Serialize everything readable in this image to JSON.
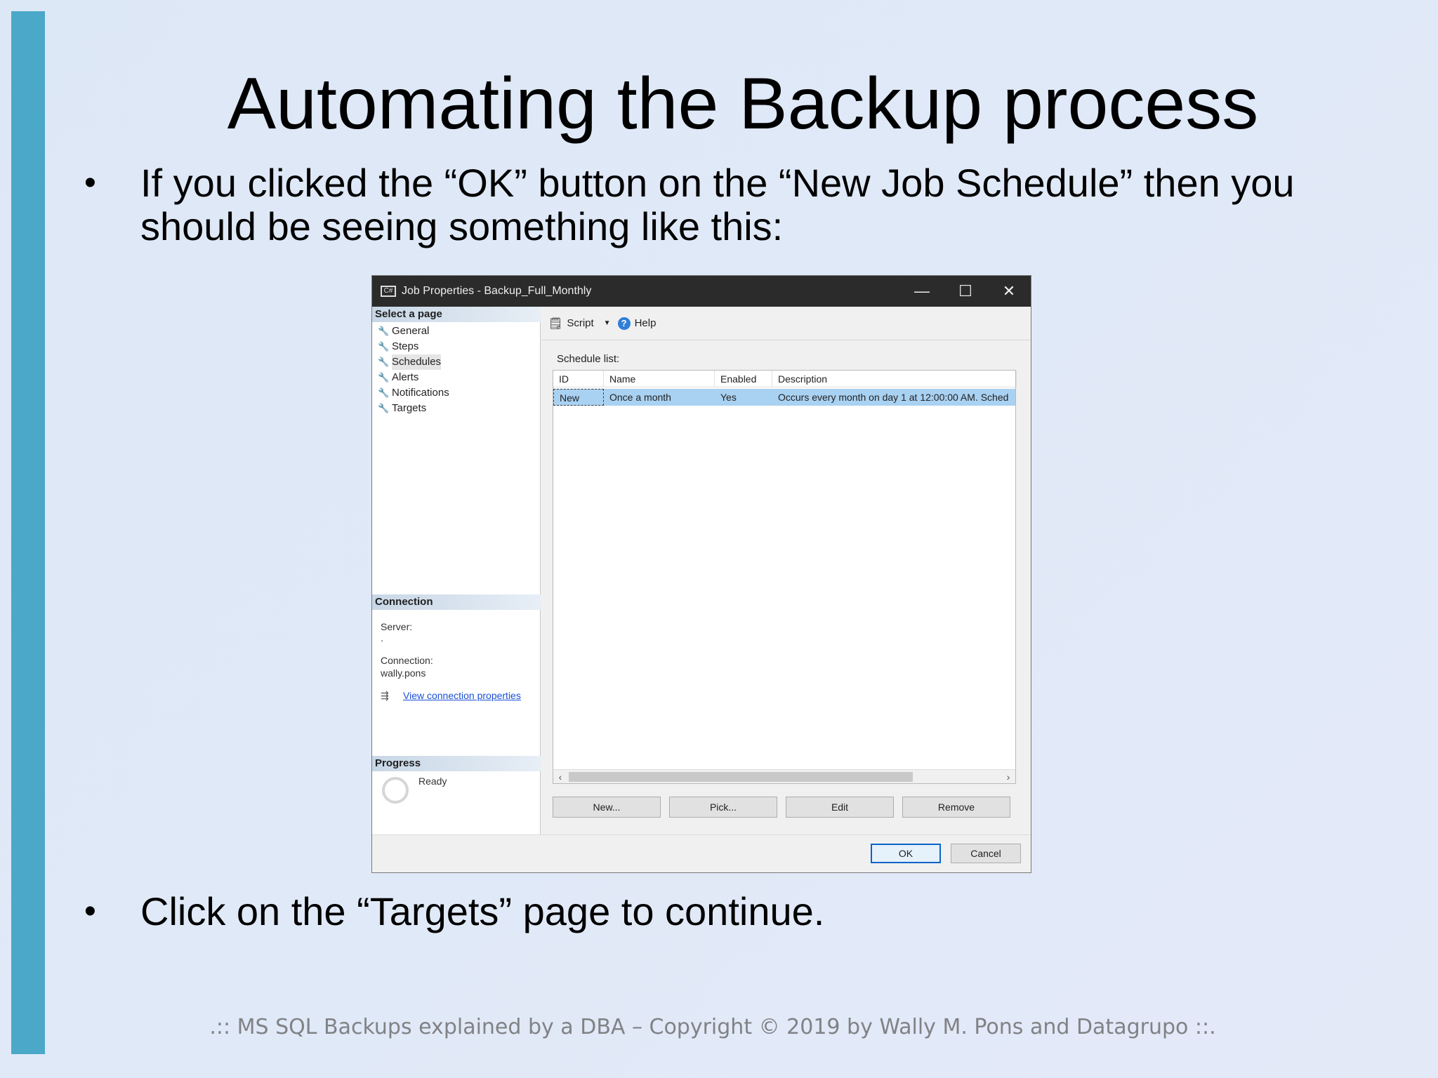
{
  "slide": {
    "title": "Automating the Backup process",
    "bullet1_line1": "If you clicked the “OK” button on the “New Job Schedule” then you",
    "bullet1_line2": "should be seeing something like this:",
    "bullet2": "Click on the “Targets” page to continue.",
    "bullet_glyph": "•",
    "footer": ".:: MS SQL Backups explained by a DBA – Copyright © 2019 by Wally M. Pons and Datagrupo ::.",
    "accent_color": "#4ba8c9"
  },
  "dialog": {
    "title": "Job Properties - Backup_Full_Monthly",
    "window_buttons": {
      "minimize": "—",
      "maximize": "☐",
      "close": "✕"
    },
    "select_page_header": "Select a page",
    "pages": [
      "General",
      "Steps",
      "Schedules",
      "Alerts",
      "Notifications",
      "Targets"
    ],
    "connection": {
      "header": "Connection",
      "server_label": "Server:",
      "server_value": ".",
      "connection_label": "Connection:",
      "connection_value": "wally.pons",
      "link": "View connection properties"
    },
    "progress": {
      "header": "Progress",
      "status": "Ready"
    },
    "toolbar": {
      "script": "Script",
      "help": "Help"
    },
    "schedule_list_label": "Schedule list:",
    "columns": [
      "ID",
      "Name",
      "Enabled",
      "Description"
    ],
    "rows": [
      {
        "id": "New",
        "name": "Once a month",
        "enabled": "Yes",
        "description": "Occurs every month on day 1 at 12:00:00 AM. Sched"
      }
    ],
    "buttons": {
      "new": "New...",
      "pick": "Pick...",
      "edit": "Edit",
      "remove": "Remove",
      "ok": "OK",
      "cancel": "Cancel"
    },
    "selection_color": "#a9d1f2"
  }
}
